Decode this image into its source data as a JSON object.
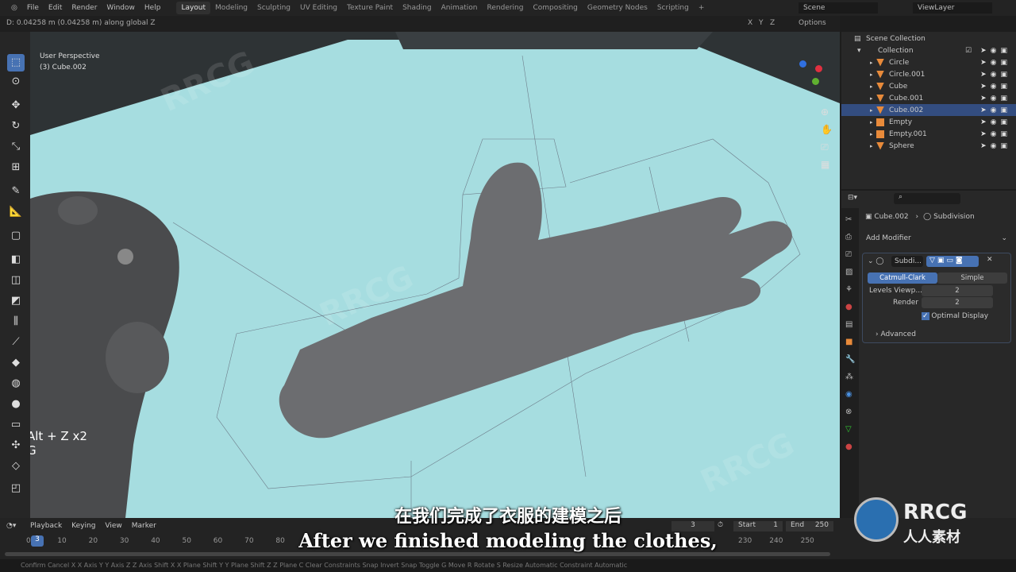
{
  "menu": {
    "items": [
      "File",
      "Edit",
      "Render",
      "Window",
      "Help"
    ],
    "workspaces": [
      "Layout",
      "Modeling",
      "Sculpting",
      "UV Editing",
      "Texture Paint",
      "Shading",
      "Animation",
      "Rendering",
      "Compositing",
      "Geometry Nodes",
      "Scripting",
      "+"
    ],
    "active": "Layout",
    "scene": "Scene",
    "view_layer": "ViewLayer"
  },
  "header": {
    "status": "D: 0.04258 m (0.04258 m) along global Z",
    "options": "Options",
    "axes": [
      "X",
      "Y",
      "Z"
    ]
  },
  "viewport": {
    "perspective": "User Perspective",
    "object": "(3) Cube.002",
    "keys": [
      "Alt + Z x2",
      "G"
    ]
  },
  "outliner": {
    "scene_collection": "Scene Collection",
    "collection": "Collection",
    "items": [
      {
        "name": "Circle",
        "type": "mesh",
        "selected": false
      },
      {
        "name": "Circle.001",
        "type": "mesh",
        "selected": false
      },
      {
        "name": "Cube",
        "type": "mesh",
        "selected": false
      },
      {
        "name": "Cube.001",
        "type": "mesh",
        "selected": false
      },
      {
        "name": "Cube.002",
        "type": "mesh",
        "selected": true
      },
      {
        "name": "Empty",
        "type": "empty",
        "selected": false
      },
      {
        "name": "Empty.001",
        "type": "empty",
        "selected": false
      },
      {
        "name": "Sphere",
        "type": "mesh",
        "selected": false
      }
    ]
  },
  "properties": {
    "object": "Cube.002",
    "modifier_tab": "Subdivision",
    "add_modifier": "Add Modifier",
    "modifier_name": "Subdi...",
    "mode_options": [
      "Catmull-Clark",
      "Simple"
    ],
    "mode_selected": "Catmull-Clark",
    "levels_label": "Levels Viewp...",
    "levels_value": "2",
    "render_label": "Render",
    "render_value": "2",
    "optimal_display": "Optimal Display",
    "optimal_checked": true,
    "advanced": "Advanced"
  },
  "timeline": {
    "menus": [
      "Playback",
      "Keying",
      "View",
      "Marker"
    ],
    "current_frame": "3",
    "start_label": "Start",
    "start": "1",
    "end_label": "End",
    "end": "250",
    "ticks_left": [
      "0",
      "10",
      "20",
      "30",
      "40",
      "50",
      "60",
      "70",
      "80"
    ],
    "ticks_right": [
      "230",
      "240",
      "250"
    ]
  },
  "status": {
    "text": "Confirm   Cancel   X X Axis   Y Y Axis   Z Z Axis   Shift X X Plane   Shift Y Y Plane   Shift Z Z Plane   C Clear Constraints   Snap Invert   Snap Toggle   G Move   R Rotate   S Resize   Automatic Constraint   Automatic"
  },
  "subtitles": {
    "zh": "在我们完成了衣服的建模之后",
    "en": "After we finished modeling the clothes,"
  },
  "watermark": {
    "brand": "RRCG",
    "cn": "人人素材"
  }
}
